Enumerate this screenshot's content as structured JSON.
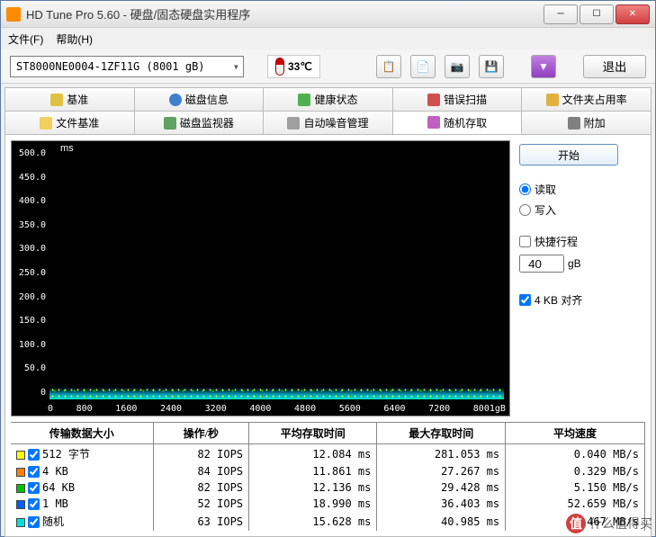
{
  "window": {
    "title": "HD Tune Pro 5.60 - 硬盘/固态硬盘实用程序"
  },
  "menu": {
    "file": "文件(F)",
    "help": "帮助(H)"
  },
  "toolbar": {
    "drive": "ST8000NE0004-1ZF11G (8001 gB)",
    "temp": "33℃",
    "exit": "退出"
  },
  "tabs_row1": [
    {
      "label": "基准",
      "icon": "ruler"
    },
    {
      "label": "磁盘信息",
      "icon": "info"
    },
    {
      "label": "健康状态",
      "icon": "health"
    },
    {
      "label": "错误扫描",
      "icon": "scan"
    },
    {
      "label": "文件夹占用率",
      "icon": "folder"
    }
  ],
  "tabs_row2": [
    {
      "label": "文件基准",
      "icon": "file"
    },
    {
      "label": "磁盘监视器",
      "icon": "monitor"
    },
    {
      "label": "自动噪音管理",
      "icon": "noise"
    },
    {
      "label": "随机存取",
      "icon": "random",
      "active": true
    },
    {
      "label": "附加",
      "icon": "extra"
    }
  ],
  "controls": {
    "start": "开始",
    "read": "读取",
    "write": "写入",
    "short_stroke": "快捷行程",
    "stroke_val": "40",
    "stroke_unit": "gB",
    "align": "4 KB 对齐"
  },
  "chart_data": {
    "type": "scatter",
    "ms_label": "ms",
    "ylim": [
      0,
      500
    ],
    "yticks": [
      "500.0",
      "450.0",
      "400.0",
      "350.0",
      "300.0",
      "250.0",
      "200.0",
      "150.0",
      "100.0",
      "50.0",
      "0"
    ],
    "xticks": [
      "0",
      "800",
      "1600",
      "2400",
      "3200",
      "4000",
      "4800",
      "5600",
      "6400",
      "7200",
      "8001gB"
    ],
    "note": "dense scatter of access-time samples concentrated below ~20ms across full 0–8001 gB range"
  },
  "results": {
    "headers": [
      "传输数据大小",
      "操作/秒",
      "平均存取时间",
      "最大存取时间",
      "平均速度"
    ],
    "rows": [
      {
        "color": "#ffff00",
        "name": "512 字节",
        "iops": "82 IOPS",
        "avg": "12.084 ms",
        "max": "281.053 ms",
        "speed": "0.040 MB/s"
      },
      {
        "color": "#ff8000",
        "name": "4 KB",
        "iops": "84 IOPS",
        "avg": "11.861 ms",
        "max": "27.267 ms",
        "speed": "0.329 MB/s"
      },
      {
        "color": "#00c000",
        "name": "64 KB",
        "iops": "82 IOPS",
        "avg": "12.136 ms",
        "max": "29.428 ms",
        "speed": "5.150 MB/s"
      },
      {
        "color": "#0060ff",
        "name": "1 MB",
        "iops": "52 IOPS",
        "avg": "18.990 ms",
        "max": "36.403 ms",
        "speed": "52.659 MB/s"
      },
      {
        "color": "#00e0e0",
        "name": "随机",
        "iops": "63 IOPS",
        "avg": "15.628 ms",
        "max": "40.985 ms",
        "speed": "32.467 MB/s"
      }
    ]
  },
  "watermark": "什么值得买"
}
